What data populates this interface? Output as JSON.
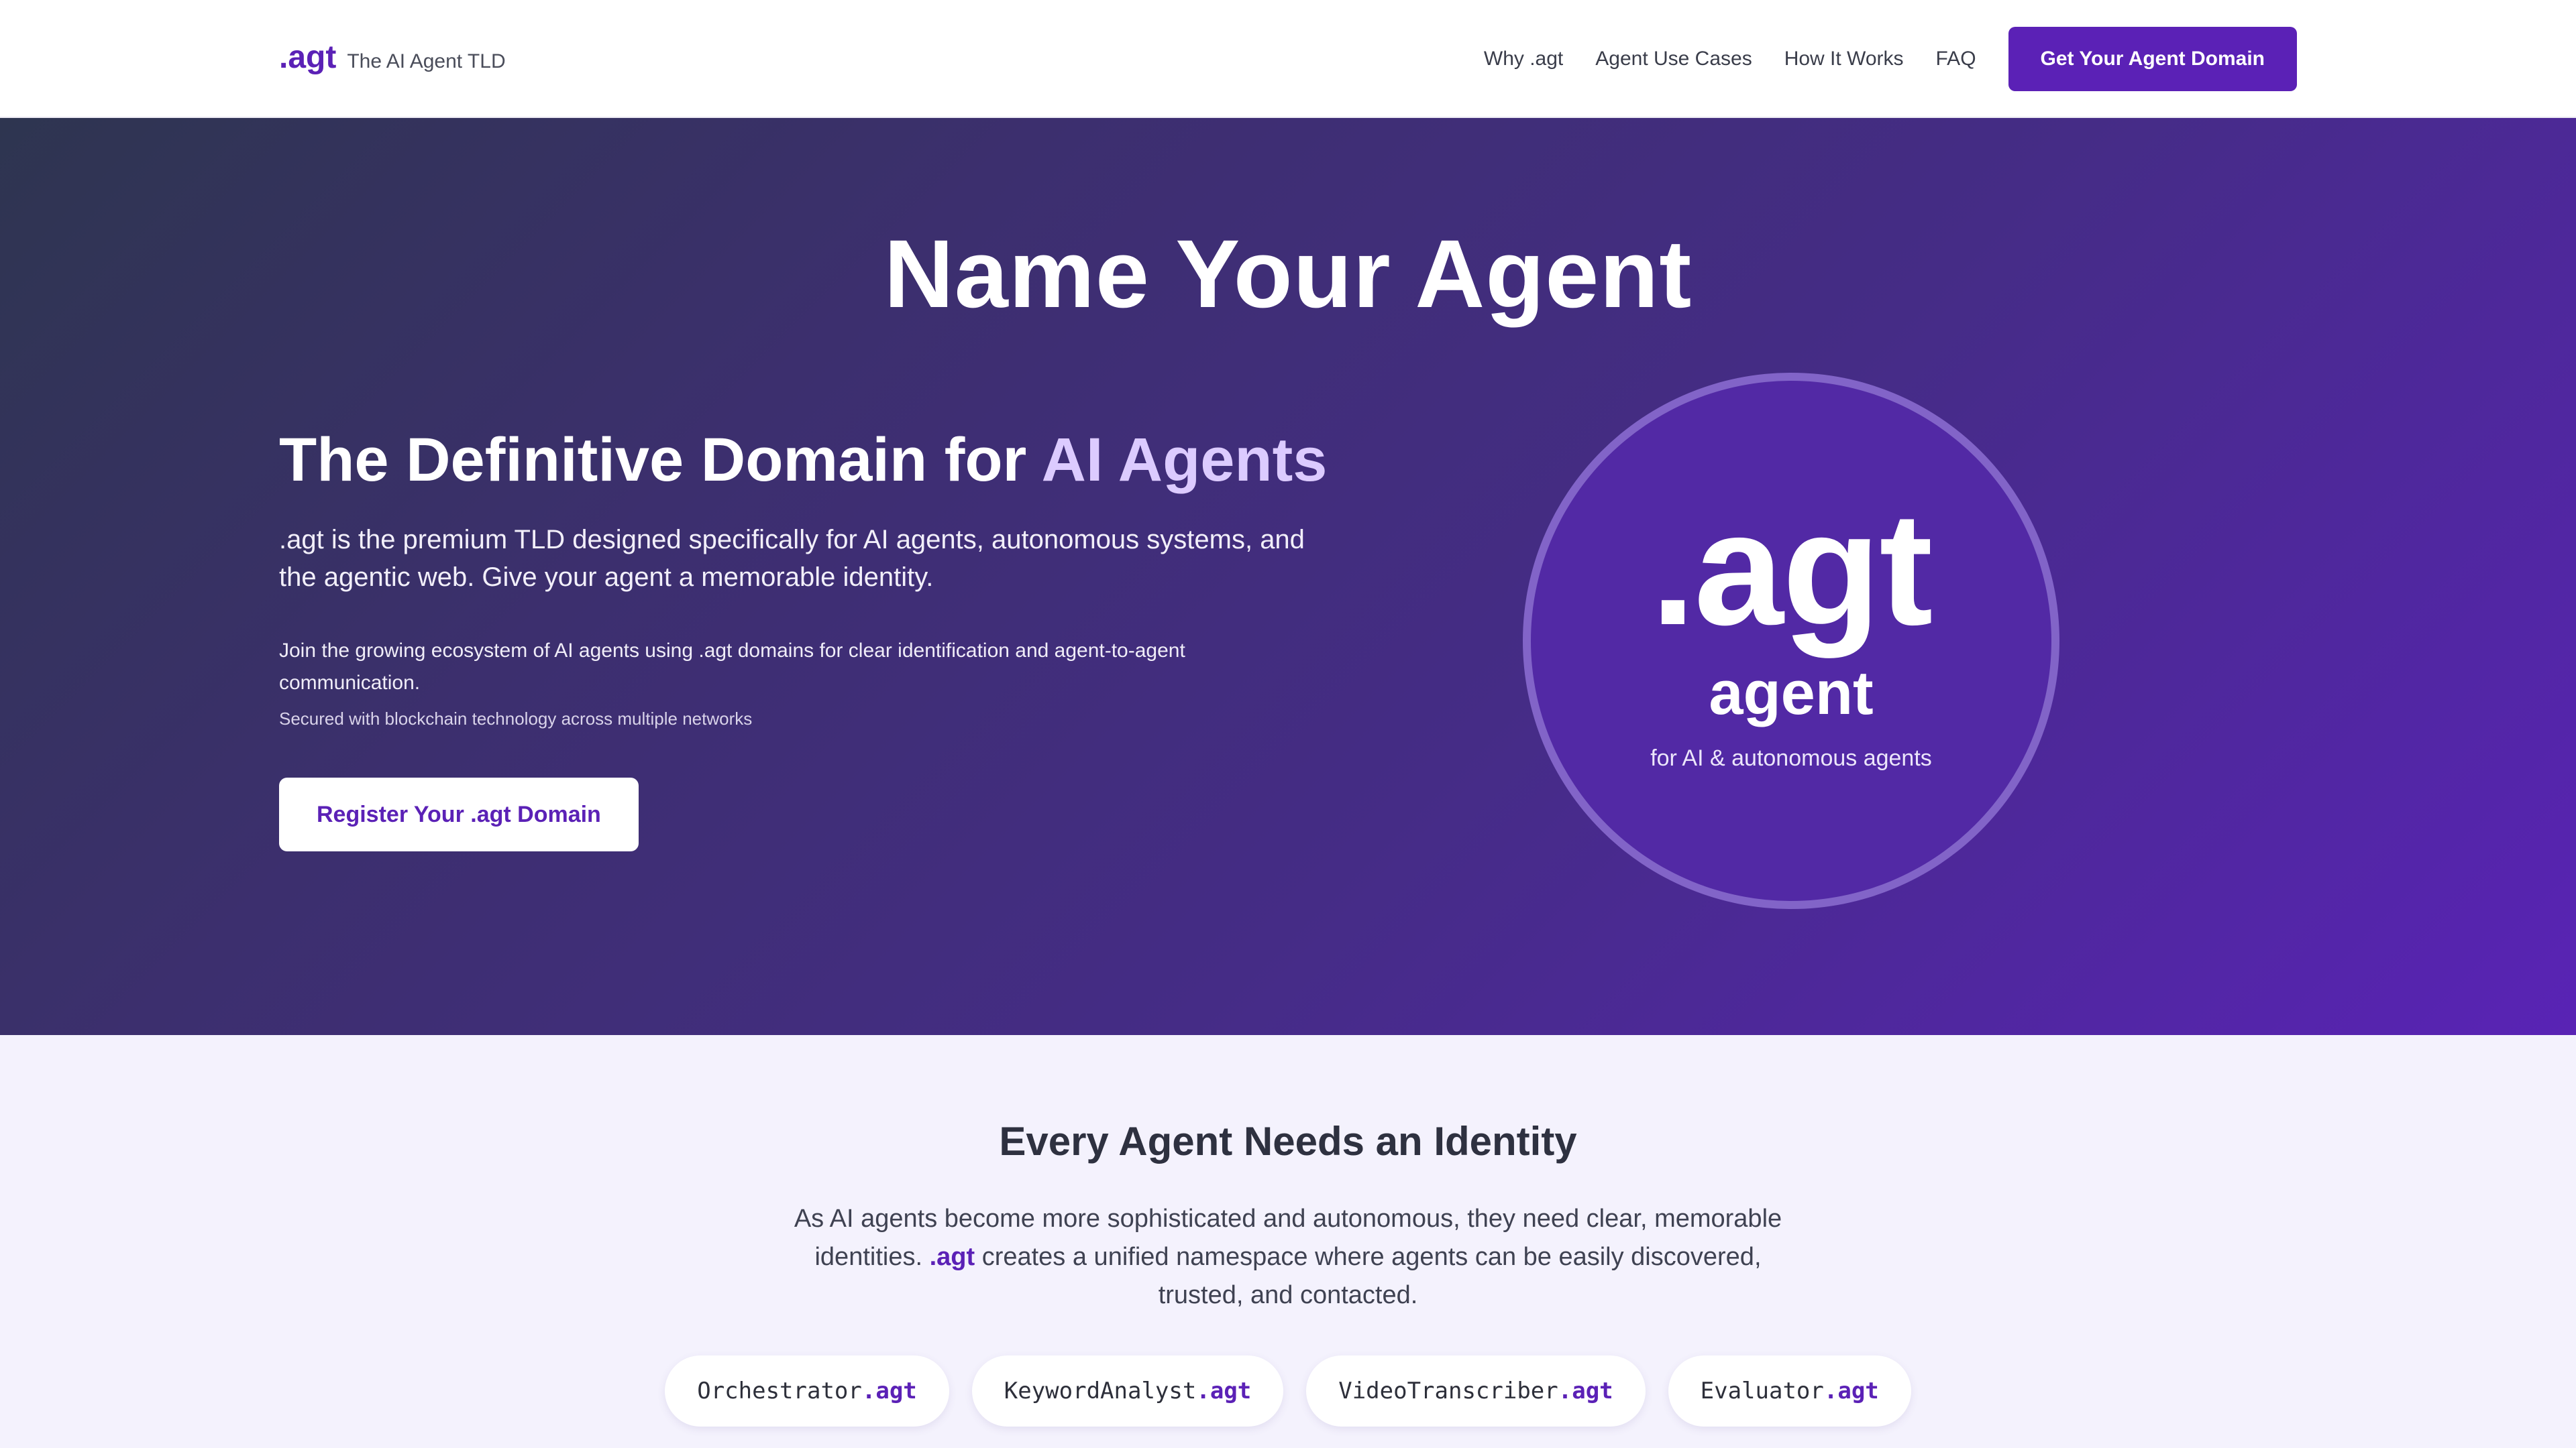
{
  "nav": {
    "logo": ".agt",
    "tagline": "The AI Agent TLD",
    "links": [
      "Why .agt",
      "Agent Use Cases",
      "How It Works",
      "FAQ"
    ],
    "cta": "Get Your Agent Domain"
  },
  "hero": {
    "title": "Name Your Agent",
    "heading_main": "The Definitive Domain for ",
    "heading_accent": "AI Agents",
    "lead": ".agt is the premium TLD designed specifically for AI agents, autonomous systems, and the agentic web. Give your agent a memorable identity.",
    "sub": "Join the growing ecosystem of AI agents using .agt domains for clear identification and agent-to-agent communication.",
    "note": "Secured with blockchain technology across multiple networks",
    "button": "Register Your .agt Domain",
    "circle": {
      "mark": ".agt",
      "word": "agent",
      "caption": "for AI & autonomous agents"
    }
  },
  "identity": {
    "title": "Every Agent Needs an Identity",
    "text_before": "As AI agents become more sophisticated and autonomous, they need clear, memorable identities. ",
    "text_highlight": ".agt",
    "text_after": " creates a unified namespace where agents can be easily discovered, trusted, and contacted.",
    "chips": [
      {
        "name": "Orchestrator",
        "tld": ".agt"
      },
      {
        "name": "KeywordAnalyst",
        "tld": ".agt"
      },
      {
        "name": "VideoTranscriber",
        "tld": ".agt"
      },
      {
        "name": "Evaluator",
        "tld": ".agt"
      }
    ]
  },
  "colors": {
    "brand": "#5b21b6",
    "accent_light": "#dccbff",
    "section_bg": "#f4f2fd"
  }
}
